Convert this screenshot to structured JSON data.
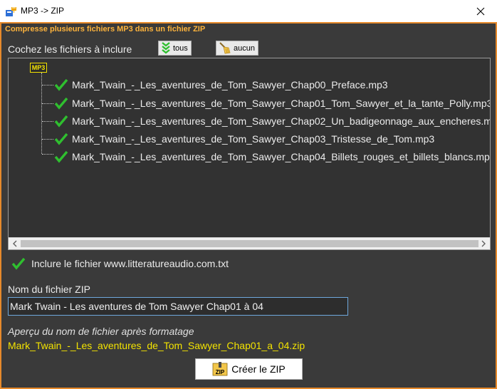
{
  "window": {
    "title": "MP3 -> ZIP"
  },
  "panel": {
    "header": "Compresse plusieurs fichiers MP3 dans un fichier ZIP",
    "check_files_label": "Cochez les fichiers à inclure",
    "btn_all": "tous",
    "btn_none": "aucun"
  },
  "tree": {
    "root_label": "MP3",
    "items": [
      {
        "label": "Mark_Twain_-_Les_aventures_de_Tom_Sawyer_Chap00_Preface.mp3",
        "checked": true
      },
      {
        "label": "Mark_Twain_-_Les_aventures_de_Tom_Sawyer_Chap01_Tom_Sawyer_et_la_tante_Polly.mp3",
        "checked": true
      },
      {
        "label": "Mark_Twain_-_Les_aventures_de_Tom_Sawyer_Chap02_Un_badigeonnage_aux_encheres.m",
        "checked": true
      },
      {
        "label": "Mark_Twain_-_Les_aventures_de_Tom_Sawyer_Chap03_Tristesse_de_Tom.mp3",
        "checked": true
      },
      {
        "label": "Mark_Twain_-_Les_aventures_de_Tom_Sawyer_Chap04_Billets_rouges_et_billets_blancs.mp",
        "checked": true
      }
    ]
  },
  "include": {
    "label": "Inclure le fichier www.litteratureaudio.com.txt",
    "checked": true
  },
  "zip": {
    "name_label": "Nom du fichier ZIP",
    "name_value": "Mark Twain - Les aventures de Tom Sawyer Chap01 à 04",
    "preview_label": "Aperçu du nom de fichier après formatage",
    "preview_value": "Mark_Twain_-_Les_aventures_de_Tom_Sawyer_Chap01_a_04.zip"
  },
  "create_button": {
    "label": "Créer le ZIP",
    "icon_text": "ZIP"
  },
  "icons": {
    "app": "mp3-zip-app-icon",
    "close": "close-icon",
    "all": "green-chevrons-down-icon",
    "none": "broom-icon",
    "check": "green-check-icon",
    "zip": "zip-file-icon"
  },
  "colors": {
    "panel_bg": "#3a3a3a",
    "panel_border": "#e78a2b",
    "header_text": "#ffb43c",
    "preview_text": "#f3e300",
    "check_green": "#2fbf2f"
  }
}
